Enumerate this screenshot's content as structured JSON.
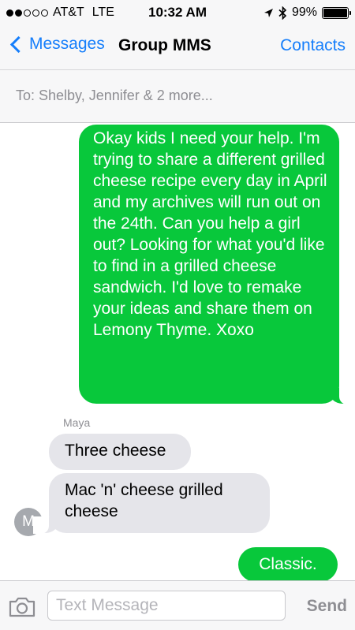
{
  "status_bar": {
    "carrier": "AT&T",
    "network": "LTE",
    "time": "10:32 AM",
    "battery": "99%",
    "battery_level": 0.99,
    "signal_bars": 2,
    "signal_total": 5,
    "icons": [
      "location-arrow-icon",
      "bluetooth-icon",
      "battery-icon"
    ]
  },
  "nav": {
    "back_label": "Messages",
    "title": "Group MMS",
    "contacts_label": "Contacts"
  },
  "to_line": {
    "text": "To: Shelby, Jennifer & 2 more..."
  },
  "messages": [
    {
      "direction": "sent",
      "text": "Okay kids I need your help. I'm trying to share a different grilled cheese recipe every day in April and my archives will run out on the 24th. Can you help a girl out? Looking for what you'd like to find in a grilled cheese sandwich. I'd love to remake your ideas and share them on Lemony Thyme. Xoxo"
    },
    {
      "direction": "received",
      "sender": "Maya",
      "text": "Three cheese"
    },
    {
      "direction": "received",
      "sender": "Maya",
      "avatar_initial": "M",
      "text": "Mac 'n' cheese grilled cheese"
    },
    {
      "direction": "sent",
      "text": "Classic."
    }
  ],
  "input_bar": {
    "placeholder": "Text Message",
    "value": "",
    "send_label": "Send"
  },
  "colors": {
    "accent_blue": "#157efb",
    "sent_bubble": "#08c83b",
    "received_bubble": "#e5e5ea",
    "bar_background": "#f7f7f8"
  }
}
